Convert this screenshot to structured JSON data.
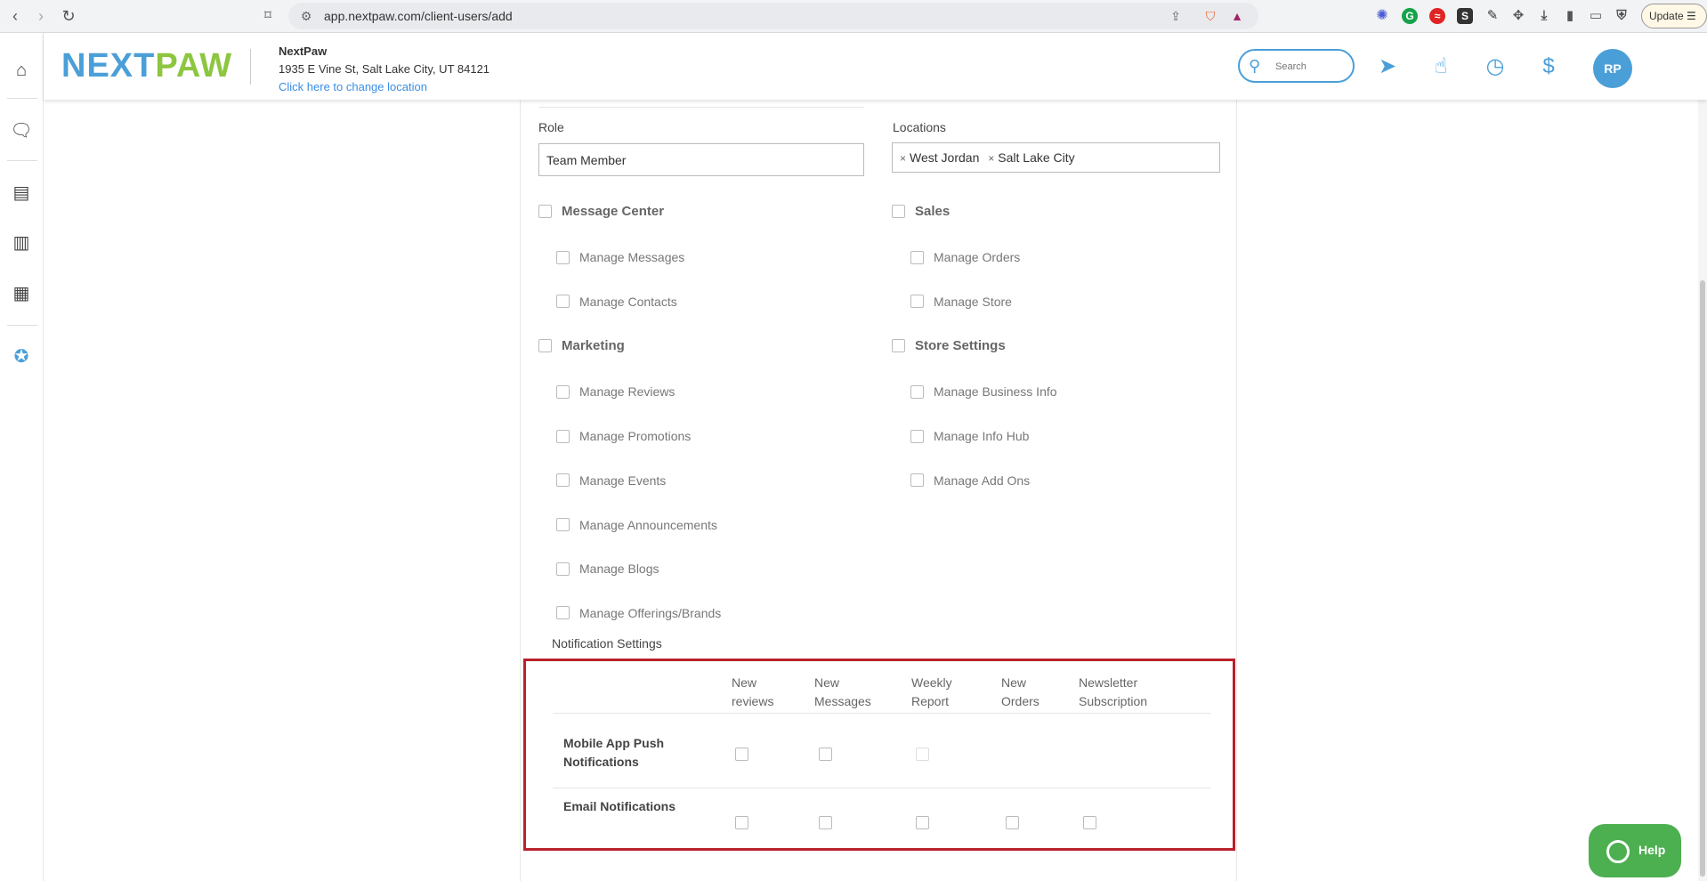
{
  "browser": {
    "url": "app.nextpaw.com/client-users/add",
    "update_label": "Update"
  },
  "header": {
    "logo_next": "NEXT",
    "logo_paw": "PAW",
    "business_name": "NextPaw",
    "business_address": "1935 E Vine St, Salt Lake City, UT 84121",
    "change_location": "Click here to change location",
    "search_placeholder": "Search",
    "avatar_initials": "RP"
  },
  "form": {
    "role_label": "Role",
    "role_value": "Team Member",
    "locations_label": "Locations",
    "locations": [
      "West Jordan",
      "Salt Lake City"
    ],
    "permissions": {
      "message_center": {
        "label": "Message Center",
        "items": [
          "Manage Messages",
          "Manage Contacts"
        ]
      },
      "sales": {
        "label": "Sales",
        "items": [
          "Manage Orders",
          "Manage Store"
        ]
      },
      "marketing": {
        "label": "Marketing",
        "items": [
          "Manage Reviews",
          "Manage Promotions",
          "Manage Events",
          "Manage Announcements",
          "Manage Blogs",
          "Manage Offerings/Brands"
        ]
      },
      "store_settings": {
        "label": "Store Settings",
        "items": [
          "Manage Business Info",
          "Manage Info Hub",
          "Manage Add Ons"
        ]
      }
    },
    "notifications": {
      "title": "Notification Settings",
      "columns": [
        [
          "New",
          "reviews"
        ],
        [
          "New",
          "Messages"
        ],
        [
          "Weekly",
          "Report"
        ],
        [
          "New",
          "Orders"
        ],
        [
          "Newsletter",
          "Subscription"
        ]
      ],
      "rows": [
        [
          "Mobile App Push",
          "Notifications"
        ],
        [
          "Email Notifications"
        ]
      ]
    }
  },
  "help_label": "Help"
}
